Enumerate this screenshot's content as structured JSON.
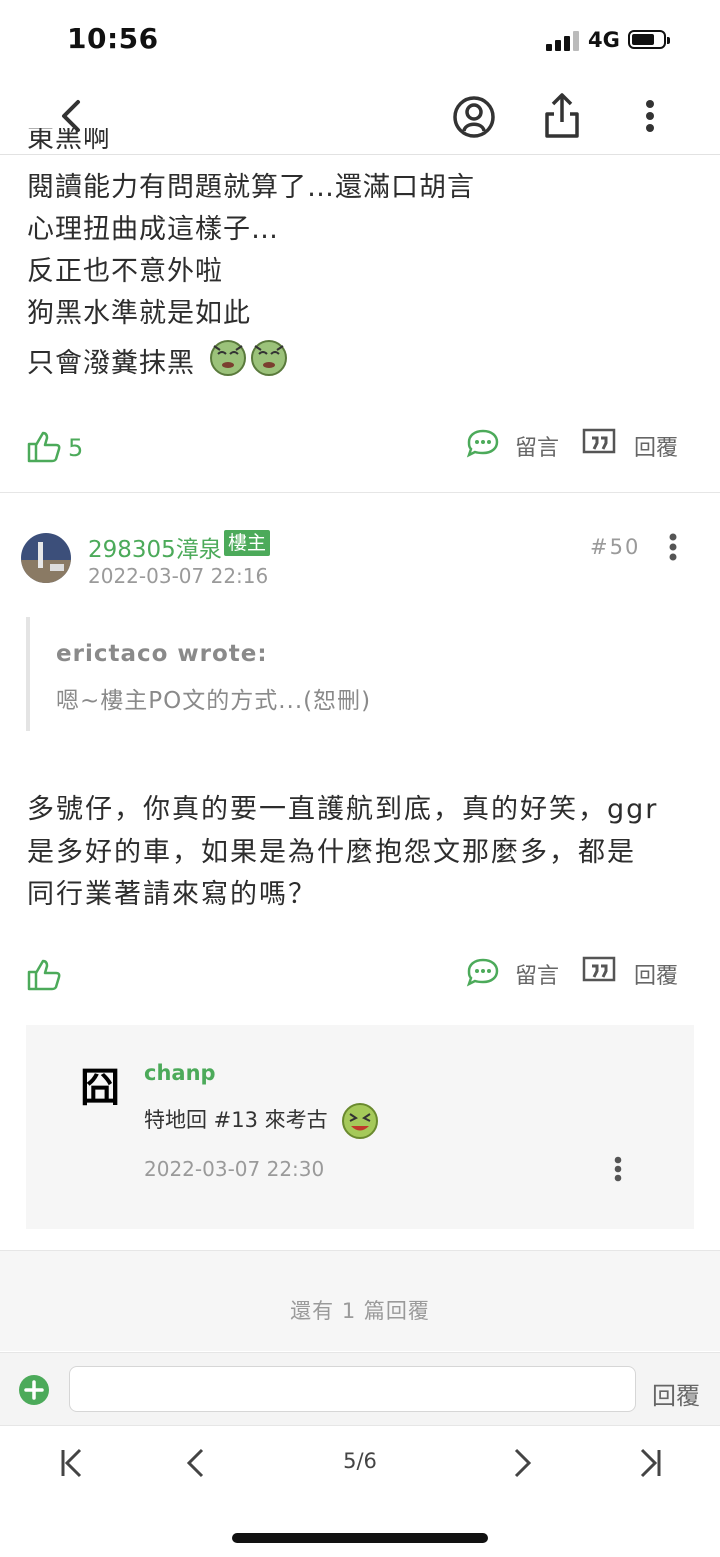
{
  "status": {
    "time": "10:56",
    "network": "4G"
  },
  "top_nav": {
    "back": "back-icon",
    "profile": "user-circle-icon",
    "share": "share-icon",
    "more": "more-vertical-icon"
  },
  "post_prev": {
    "cut_line": "東黑啊",
    "lines": [
      "閱讀能力有問題就算了…還滿口胡言",
      "心理扭曲成這樣子…",
      "反正也不意外啦",
      "狗黑水準就是如此",
      "只會潑糞抹黑"
    ],
    "like_count": "5",
    "comment_label": "留言",
    "reply_label": "回覆"
  },
  "post": {
    "author": "298305漳泉",
    "owner_badge": "樓主",
    "floor": "#50",
    "timestamp": "2022-03-07 22:16",
    "quote_author": "erictaco wrote:",
    "quote_text": "嗯~樓主PO文的方式...(恕刪)",
    "lines": [
      "多號仔，你真的要一直護航到底，真的好笑，ggr",
      "是多好的車，如果是為什麼抱怨文那麼多，都是",
      "同行業著請來寫的嗎？"
    ],
    "comment_label": "留言",
    "reply_label": "回覆"
  },
  "comment": {
    "avatar_char": "囧",
    "author": "chanp",
    "text": "特地回 #13 來考古",
    "timestamp": "2022-03-07 22:30"
  },
  "more_replies": "還有 1 篇回覆",
  "composer": {
    "placeholder": "",
    "send_label": "回覆"
  },
  "pager": {
    "page": "5/6"
  },
  "colors": {
    "accent": "#4caa5a",
    "text": "#2d2d2d",
    "muted": "#9a9a9a"
  }
}
